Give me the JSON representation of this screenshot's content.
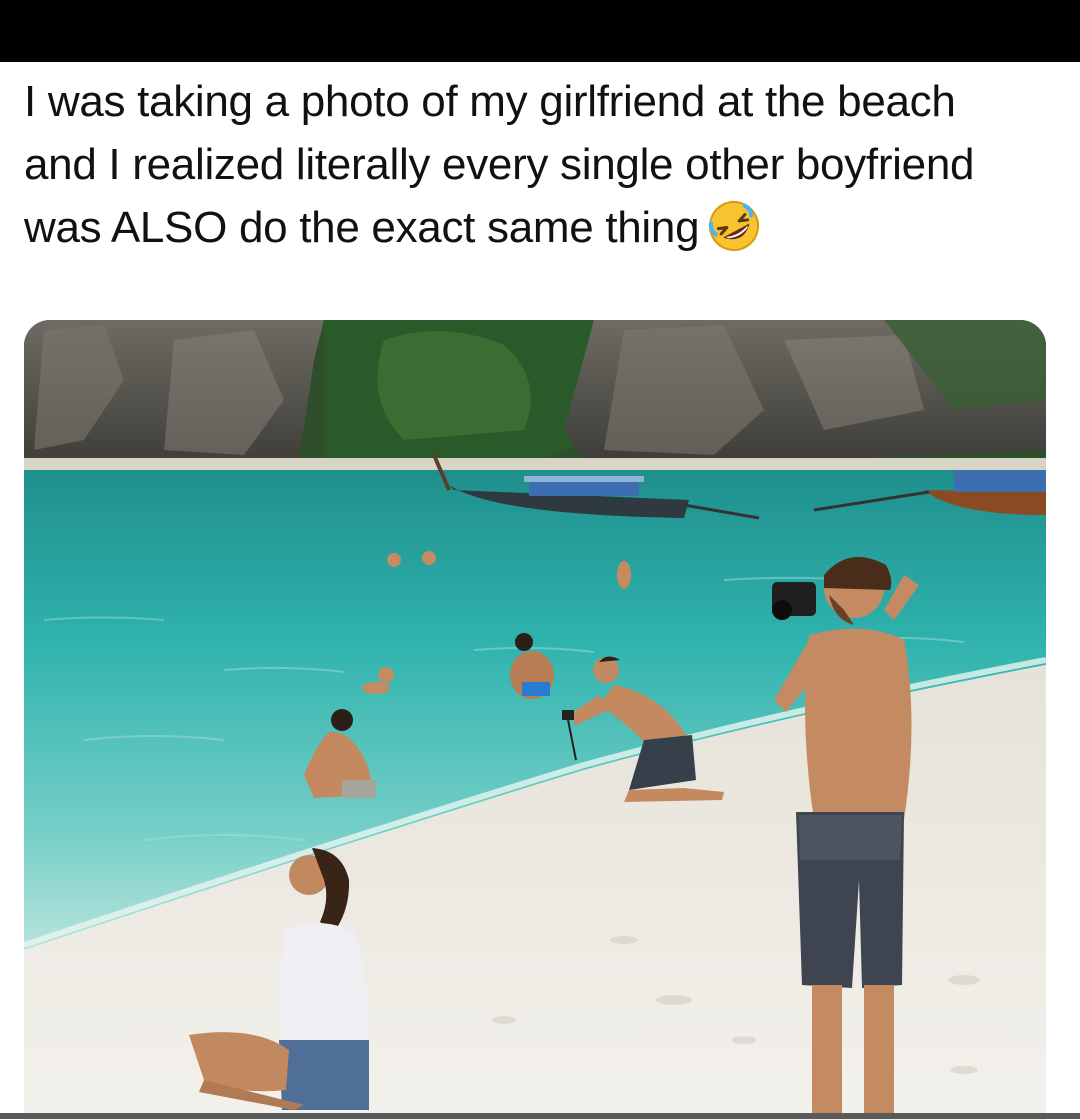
{
  "post": {
    "caption_lines": [
      "I was taking a photo of my girlfriend at the beach",
      "and I realized literally every single other boyfriend",
      "was ALSO do the exact same thing"
    ],
    "emoji": "rolling-on-floor-laughing-icon"
  },
  "photo": {
    "subject": "beach-photo",
    "colors": {
      "water": "#2fb2ad",
      "sand": "#ece9e2",
      "cliff": "#5b5b55",
      "jungle": "#2f5a2c"
    }
  }
}
